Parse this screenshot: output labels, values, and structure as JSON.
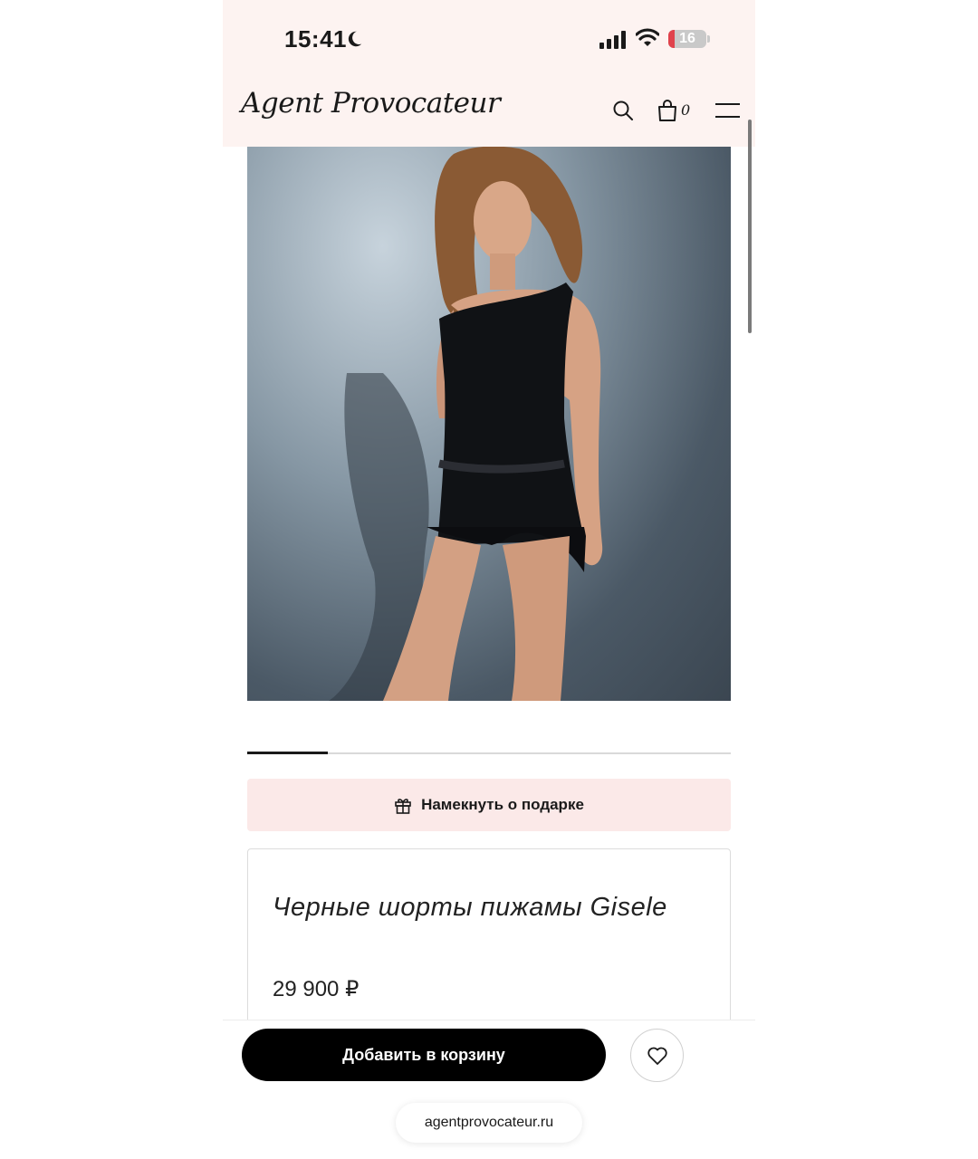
{
  "status_bar": {
    "time": "15:41",
    "battery_level": "16",
    "battery_fraction": 0.16
  },
  "header": {
    "logo": "Agent Provocateur",
    "cart_count": "0"
  },
  "gallery": {
    "image_icon": "product-photo"
  },
  "gift_hint": {
    "label": "Намекнуть о подарке"
  },
  "product": {
    "title": "Черные шорты пижамы Gisele",
    "price": "29 900 ₽"
  },
  "actions": {
    "add_to_cart": "Добавить в корзину"
  },
  "browser": {
    "url": "agentprovocateur.ru"
  },
  "colors": {
    "header_bg": "#fdf3f1",
    "gift_button_bg": "#fbe9e8",
    "primary_button": "#000000",
    "battery_low": "#e0424c"
  }
}
